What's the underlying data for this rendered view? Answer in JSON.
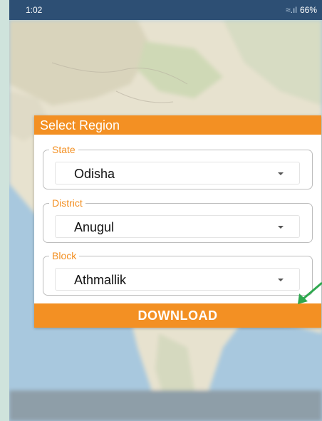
{
  "status_bar": {
    "time": "1:02",
    "battery": "66%"
  },
  "dialog": {
    "title": "Select Region",
    "fields": [
      {
        "legend": "State",
        "value": "Odisha"
      },
      {
        "legend": "District",
        "value": "Anugul"
      },
      {
        "legend": "Block",
        "value": "Athmallik"
      }
    ],
    "download_label": "DOWNLOAD"
  },
  "colors": {
    "accent": "#f39023",
    "status_bar": "#2d4f74",
    "annotation_arrow": "#2fa84f"
  }
}
